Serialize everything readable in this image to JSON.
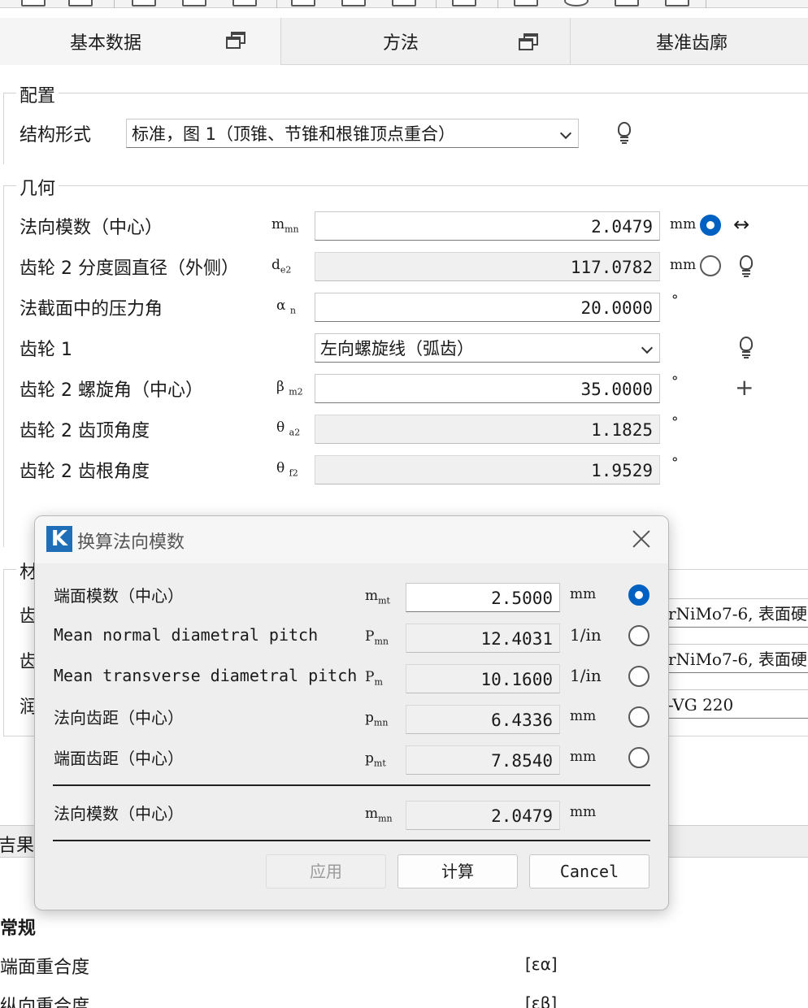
{
  "tabs": [
    {
      "label": "基本数据"
    },
    {
      "label": "方法"
    },
    {
      "label": "基准齿廓"
    }
  ],
  "config": {
    "title": "配置",
    "structure_label": "结构形式",
    "structure_value": "标准，图 1（顶锥、节锥和根锥顶点重合）"
  },
  "geometry": {
    "title": "几何",
    "rows": [
      {
        "label": "法向模数（中心）",
        "sym": "m",
        "sub": "mn",
        "value": "2.0479",
        "unit": "mm"
      },
      {
        "label": "齿轮 2 分度圆直径（外侧）",
        "sym": "d",
        "sub": "e2",
        "value": "117.0782",
        "unit": "mm"
      },
      {
        "label": "法截面中的压力角",
        "sym": "α",
        "sub": "n",
        "value": "20.0000",
        "unit": "°"
      },
      {
        "label": "齿轮 1",
        "combo": "左向螺旋线（弧齿）"
      },
      {
        "label": "齿轮 2 螺旋角（中心）",
        "sym": "β",
        "sub": "m2",
        "value": "35.0000",
        "unit": "°"
      },
      {
        "label": "齿轮 2 齿顶角度",
        "sym": "θ",
        "sub": "a2",
        "value": "1.1825",
        "unit": "°"
      },
      {
        "label": "齿轮 2 齿根角度",
        "sym": "θ",
        "sub": "f2",
        "value": "1.9529",
        "unit": "°"
      }
    ]
  },
  "material": {
    "title_partial": "材",
    "row1_label_partial": "齿",
    "row1_value_partial": "rNiMo7-6, 表面硬",
    "row2_label_partial": "齿",
    "row2_value_partial": "rNiMo7-6, 表面硬",
    "row3_label_partial": "润",
    "row3_value_partial": "-VG 220"
  },
  "dialog": {
    "title": "换算法向模数",
    "logo": "K",
    "rows": [
      {
        "label": "端面模数（中心）",
        "sym": "m",
        "sub": "mt",
        "value": "2.5000",
        "unit": "mm",
        "selected": true
      },
      {
        "label": "Mean normal diametral pitch",
        "sym": "P",
        "sub": "mn",
        "value": "12.4031",
        "unit": "1/in",
        "selected": false
      },
      {
        "label": "Mean transverse diametral pitch",
        "sym": "P",
        "sub": "m",
        "value": "10.1600",
        "unit": "1/in",
        "selected": false
      },
      {
        "label": "法向齿距（中心）",
        "sym": "p",
        "sub": "mn",
        "value": "6.4336",
        "unit": "mm",
        "selected": false
      },
      {
        "label": "端面齿距（中心）",
        "sym": "p",
        "sub": "mt",
        "value": "7.8540",
        "unit": "mm",
        "selected": false
      }
    ],
    "result": {
      "label": "法向模数（中心）",
      "sym": "m",
      "sub": "mn",
      "value": "2.0479",
      "unit": "mm"
    },
    "buttons": {
      "apply": "应用",
      "calculate": "计算",
      "cancel": "Cancel"
    }
  },
  "results": {
    "bar_label_partial": "吉果",
    "section_title": "常规",
    "row1_label": "端面重合度",
    "row1_sym": "[εα]",
    "row2_label_partial": "纵向重合度",
    "row2_sym_partial": "[εβ]"
  },
  "colors": {
    "accent": "#0061c2",
    "logo": "#1f6fb8"
  }
}
